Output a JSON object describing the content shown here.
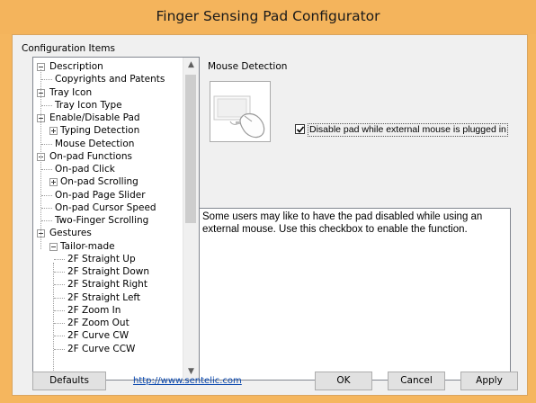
{
  "window": {
    "title": "Finger Sensing Pad Configurator"
  },
  "config": {
    "group_label": "Configuration Items",
    "tree": [
      {
        "label": "Description",
        "level": 0,
        "expander": "minus"
      },
      {
        "label": "Copyrights and Patents",
        "level": 1,
        "expander": "none"
      },
      {
        "label": "Tray Icon",
        "level": 0,
        "expander": "minus"
      },
      {
        "label": "Tray Icon Type",
        "level": 1,
        "expander": "none"
      },
      {
        "label": "Enable/Disable Pad",
        "level": 0,
        "expander": "minus"
      },
      {
        "label": "Typing Detection",
        "level": 1,
        "expander": "plus"
      },
      {
        "label": "Mouse Detection",
        "level": 1,
        "expander": "none"
      },
      {
        "label": "On-pad Functions",
        "level": 0,
        "expander": "minus"
      },
      {
        "label": "On-pad Click",
        "level": 1,
        "expander": "none"
      },
      {
        "label": "On-pad Scrolling",
        "level": 1,
        "expander": "plus"
      },
      {
        "label": "On-pad Page Slider",
        "level": 1,
        "expander": "none"
      },
      {
        "label": "On-pad Cursor Speed",
        "level": 1,
        "expander": "none"
      },
      {
        "label": "Two-Finger Scrolling",
        "level": 1,
        "expander": "none"
      },
      {
        "label": "Gestures",
        "level": 0,
        "expander": "minus"
      },
      {
        "label": "Tailor-made",
        "level": 1,
        "expander": "minus"
      },
      {
        "label": "2F Straight Up",
        "level": 2,
        "expander": "none"
      },
      {
        "label": "2F Straight Down",
        "level": 2,
        "expander": "none"
      },
      {
        "label": "2F Straight Right",
        "level": 2,
        "expander": "none"
      },
      {
        "label": "2F Straight Left",
        "level": 2,
        "expander": "none"
      },
      {
        "label": "2F Zoom In",
        "level": 2,
        "expander": "none"
      },
      {
        "label": "2F Zoom Out",
        "level": 2,
        "expander": "none"
      },
      {
        "label": "2F Curve CW",
        "level": 2,
        "expander": "none"
      },
      {
        "label": "2F Curve CCW",
        "level": 2,
        "expander": "none"
      }
    ]
  },
  "detail": {
    "section_title": "Mouse Detection",
    "image_icon": "mouse-with-pad-icon",
    "checkbox_label": "Disable pad while external mouse is plugged in",
    "checkbox_checked": true,
    "description": "Some users may like to have the pad disabled while using an external mouse. Use this checkbox to enable the function."
  },
  "footer": {
    "defaults_label": "Defaults",
    "link_text": "http://www.sentelic.com",
    "ok_label": "OK",
    "cancel_label": "Cancel",
    "apply_label": "Apply"
  },
  "colors": {
    "title_bar": "#f4b45c",
    "client_bg": "#f0f0f0",
    "link": "#0645ad"
  }
}
